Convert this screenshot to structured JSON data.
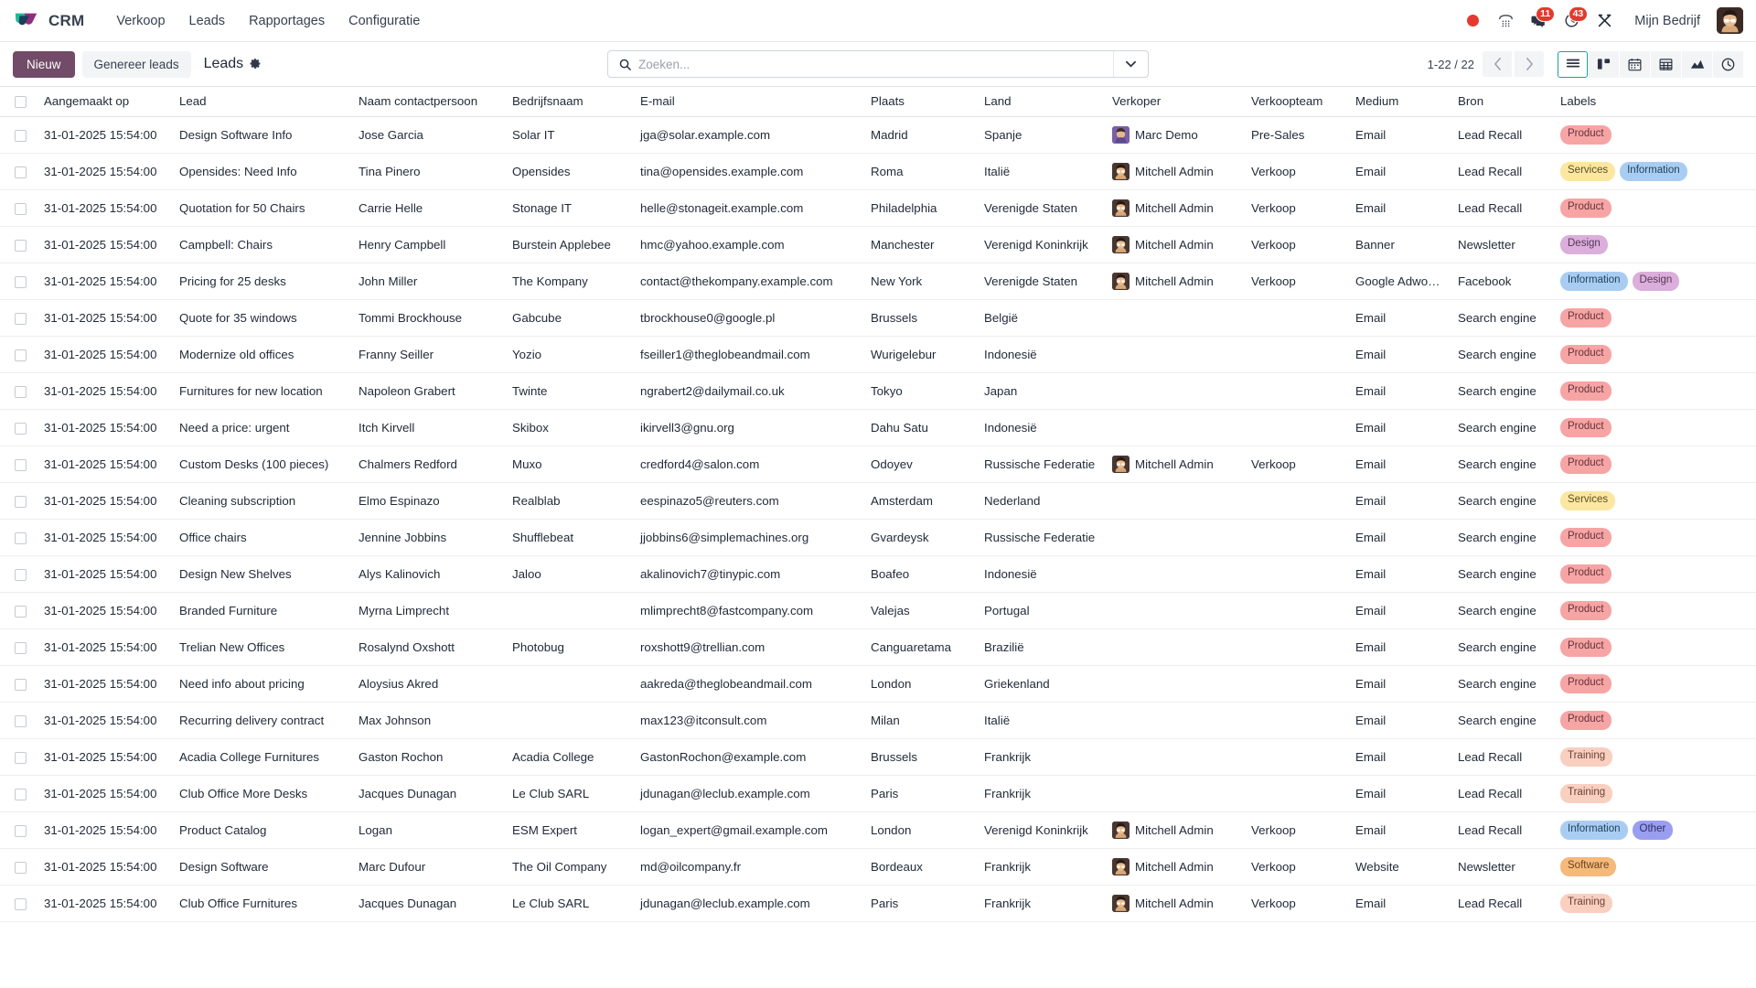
{
  "navbar": {
    "app_name": "CRM",
    "menu": [
      {
        "label": "Verkoop",
        "name": "menu-verkoop"
      },
      {
        "label": "Leads",
        "name": "menu-leads"
      },
      {
        "label": "Rapportages",
        "name": "menu-rapportages"
      },
      {
        "label": "Configuratie",
        "name": "menu-configuratie"
      }
    ],
    "systray": {
      "recording_icon": "record-dot-icon",
      "dialpad_icon": "dialpad-icon",
      "messages_icon": "messages-icon",
      "messages_count": "11",
      "activities_icon": "clock-icon",
      "activities_count": "43",
      "tools_icon": "crossed-tools-icon"
    },
    "company": "Mijn Bedrijf",
    "avatar_icon": "user-avatar"
  },
  "control_panel": {
    "new_label": "Nieuw",
    "generate_leads_label": "Genereer leads",
    "breadcrumb": "Leads",
    "settings_icon": "gear-icon",
    "search": {
      "placeholder": "Zoeken...",
      "value": "",
      "icon": "search-icon",
      "dropdown_icon": "chevron-down-icon"
    },
    "pager": "1-22 / 22",
    "prev_icon": "chevron-left-icon",
    "next_icon": "chevron-right-icon",
    "views": [
      {
        "name": "view-list",
        "label": "Lijst",
        "active": true
      },
      {
        "name": "view-kanban",
        "label": "Kanban",
        "active": false
      },
      {
        "name": "view-calendar",
        "label": "Kalender",
        "active": false
      },
      {
        "name": "view-pivot",
        "label": "Draaitabel",
        "active": false
      },
      {
        "name": "view-graph",
        "label": "Grafiek",
        "active": false
      },
      {
        "name": "view-activity",
        "label": "Activiteit",
        "active": false
      }
    ]
  },
  "list": {
    "columns": [
      {
        "label": "Aangemaakt op",
        "key": "created_on",
        "width": "148"
      },
      {
        "label": "Lead",
        "key": "lead",
        "width": "196"
      },
      {
        "label": "Naam contactpersoon",
        "key": "contact_name",
        "width": "168"
      },
      {
        "label": "Bedrijfsnaam",
        "key": "company",
        "width": "140"
      },
      {
        "label": "E-mail",
        "key": "email",
        "width": "252"
      },
      {
        "label": "Plaats",
        "key": "city",
        "width": "124"
      },
      {
        "label": "Land",
        "key": "country",
        "width": "140"
      },
      {
        "label": "Verkoper",
        "key": "salesperson",
        "width": "152"
      },
      {
        "label": "Verkoopteam",
        "key": "sales_team",
        "width": "114"
      },
      {
        "label": "Medium",
        "key": "medium",
        "width": "112"
      },
      {
        "label": "Bron",
        "key": "source",
        "width": "112"
      },
      {
        "label": "Labels",
        "key": "tags",
        "width": "204"
      }
    ],
    "optional_columns_icon": "column-settings-icon",
    "select_all_name": "select-all-checkbox",
    "rows": [
      {
        "created_on": "31-01-2025 15:54:00",
        "lead": "Design Software Info",
        "contact_name": "Jose Garcia",
        "company": "Solar IT",
        "email": "jga@solar.example.com",
        "city": "Madrid",
        "country": "Spanje",
        "salesperson": "Marc Demo",
        "avatar": "marc",
        "sales_team": "Pre-Sales",
        "medium": "Email",
        "source": "Lead Recall",
        "tags": [
          {
            "label": "Product",
            "color": "product"
          }
        ]
      },
      {
        "created_on": "31-01-2025 15:54:00",
        "lead": "Opensides: Need Info",
        "contact_name": "Tina Pinero",
        "company": "Opensides",
        "email": "tina@opensides.example.com",
        "city": "Roma",
        "country": "Italië",
        "salesperson": "Mitchell Admin",
        "avatar": "admin",
        "sales_team": "Verkoop",
        "medium": "Email",
        "source": "Lead Recall",
        "tags": [
          {
            "label": "Services",
            "color": "services"
          },
          {
            "label": "Information",
            "color": "information"
          }
        ]
      },
      {
        "created_on": "31-01-2025 15:54:00",
        "lead": "Quotation for 50 Chairs",
        "contact_name": "Carrie Helle",
        "company": "Stonage IT",
        "email": "helle@stonageit.example.com",
        "city": "Philadelphia",
        "country": "Verenigde Staten",
        "salesperson": "Mitchell Admin",
        "avatar": "admin",
        "sales_team": "Verkoop",
        "medium": "Email",
        "source": "Lead Recall",
        "tags": [
          {
            "label": "Product",
            "color": "product"
          }
        ]
      },
      {
        "created_on": "31-01-2025 15:54:00",
        "lead": "Campbell: Chairs",
        "contact_name": "Henry Campbell",
        "company": "Burstein Applebee",
        "email": "hmc@yahoo.example.com",
        "city": "Manchester",
        "country": "Verenigd Koninkrijk",
        "salesperson": "Mitchell Admin",
        "avatar": "admin",
        "sales_team": "Verkoop",
        "medium": "Banner",
        "source": "Newsletter",
        "tags": [
          {
            "label": "Design",
            "color": "design"
          }
        ]
      },
      {
        "created_on": "31-01-2025 15:54:00",
        "lead": "Pricing for 25 desks",
        "contact_name": "John Miller",
        "company": "The Kompany",
        "email": "contact@thekompany.example.com",
        "city": "New York",
        "country": "Verenigde Staten",
        "salesperson": "Mitchell Admin",
        "avatar": "admin",
        "sales_team": "Verkoop",
        "medium": "Google Adwords",
        "source": "Facebook",
        "tags": [
          {
            "label": "Information",
            "color": "information"
          },
          {
            "label": "Design",
            "color": "design"
          }
        ]
      },
      {
        "created_on": "31-01-2025 15:54:00",
        "lead": "Quote for 35 windows",
        "contact_name": "Tommi Brockhouse",
        "company": "Gabcube",
        "email": "tbrockhouse0@google.pl",
        "city": "Brussels",
        "country": "België",
        "salesperson": "",
        "avatar": "",
        "sales_team": "",
        "medium": "Email",
        "source": "Search engine",
        "tags": [
          {
            "label": "Product",
            "color": "product"
          }
        ]
      },
      {
        "created_on": "31-01-2025 15:54:00",
        "lead": "Modernize old offices",
        "contact_name": "Franny Seiller",
        "company": "Yozio",
        "email": "fseiller1@theglobeandmail.com",
        "city": "Wurigelebur",
        "country": "Indonesië",
        "salesperson": "",
        "avatar": "",
        "sales_team": "",
        "medium": "Email",
        "source": "Search engine",
        "tags": [
          {
            "label": "Product",
            "color": "product"
          }
        ]
      },
      {
        "created_on": "31-01-2025 15:54:00",
        "lead": "Furnitures for new location",
        "contact_name": "Napoleon Grabert",
        "company": "Twinte",
        "email": "ngrabert2@dailymail.co.uk",
        "city": "Tokyo",
        "country": "Japan",
        "salesperson": "",
        "avatar": "",
        "sales_team": "",
        "medium": "Email",
        "source": "Search engine",
        "tags": [
          {
            "label": "Product",
            "color": "product"
          }
        ]
      },
      {
        "created_on": "31-01-2025 15:54:00",
        "lead": "Need a price: urgent",
        "contact_name": "Itch Kirvell",
        "company": "Skibox",
        "email": "ikirvell3@gnu.org",
        "city": "Dahu Satu",
        "country": "Indonesië",
        "salesperson": "",
        "avatar": "",
        "sales_team": "",
        "medium": "Email",
        "source": "Search engine",
        "tags": [
          {
            "label": "Product",
            "color": "product"
          }
        ]
      },
      {
        "created_on": "31-01-2025 15:54:00",
        "lead": "Custom Desks (100 pieces)",
        "contact_name": "Chalmers Redford",
        "company": "Muxo",
        "email": "credford4@salon.com",
        "city": "Odoyev",
        "country": "Russische Federatie",
        "salesperson": "Mitchell Admin",
        "avatar": "admin",
        "sales_team": "Verkoop",
        "medium": "Email",
        "source": "Search engine",
        "tags": [
          {
            "label": "Product",
            "color": "product"
          }
        ]
      },
      {
        "created_on": "31-01-2025 15:54:00",
        "lead": "Cleaning subscription",
        "contact_name": "Elmo Espinazo",
        "company": "Realblab",
        "email": "eespinazo5@reuters.com",
        "city": "Amsterdam",
        "country": "Nederland",
        "salesperson": "",
        "avatar": "",
        "sales_team": "",
        "medium": "Email",
        "source": "Search engine",
        "tags": [
          {
            "label": "Services",
            "color": "services"
          }
        ]
      },
      {
        "created_on": "31-01-2025 15:54:00",
        "lead": "Office chairs",
        "contact_name": "Jennine Jobbins",
        "company": "Shufflebeat",
        "email": "jjobbins6@simplemachines.org",
        "city": "Gvardeysk",
        "country": "Russische Federatie",
        "salesperson": "",
        "avatar": "",
        "sales_team": "",
        "medium": "Email",
        "source": "Search engine",
        "tags": [
          {
            "label": "Product",
            "color": "product"
          }
        ]
      },
      {
        "created_on": "31-01-2025 15:54:00",
        "lead": "Design New Shelves",
        "contact_name": "Alys Kalinovich",
        "company": "Jaloo",
        "email": "akalinovich7@tinypic.com",
        "city": "Boafeo",
        "country": "Indonesië",
        "salesperson": "",
        "avatar": "",
        "sales_team": "",
        "medium": "Email",
        "source": "Search engine",
        "tags": [
          {
            "label": "Product",
            "color": "product"
          }
        ]
      },
      {
        "created_on": "31-01-2025 15:54:00",
        "lead": "Branded Furniture",
        "contact_name": "Myrna Limprecht",
        "company": "",
        "email": "mlimprecht8@fastcompany.com",
        "city": "Valejas",
        "country": "Portugal",
        "salesperson": "",
        "avatar": "",
        "sales_team": "",
        "medium": "Email",
        "source": "Search engine",
        "tags": [
          {
            "label": "Product",
            "color": "product"
          }
        ]
      },
      {
        "created_on": "31-01-2025 15:54:00",
        "lead": "Trelian New Offices",
        "contact_name": "Rosalynd Oxshott",
        "company": "Photobug",
        "email": "roxshott9@trellian.com",
        "city": "Canguaretama",
        "country": "Brazilië",
        "salesperson": "",
        "avatar": "",
        "sales_team": "",
        "medium": "Email",
        "source": "Search engine",
        "tags": [
          {
            "label": "Product",
            "color": "product"
          }
        ]
      },
      {
        "created_on": "31-01-2025 15:54:00",
        "lead": "Need info about pricing",
        "contact_name": "Aloysius Akred",
        "company": "",
        "email": "aakreda@theglobeandmail.com",
        "city": "London",
        "country": "Griekenland",
        "salesperson": "",
        "avatar": "",
        "sales_team": "",
        "medium": "Email",
        "source": "Search engine",
        "tags": [
          {
            "label": "Product",
            "color": "product"
          }
        ]
      },
      {
        "created_on": "31-01-2025 15:54:00",
        "lead": "Recurring delivery contract",
        "contact_name": "Max Johnson",
        "company": "",
        "email": "max123@itconsult.com",
        "city": "Milan",
        "country": "Italië",
        "salesperson": "",
        "avatar": "",
        "sales_team": "",
        "medium": "Email",
        "source": "Search engine",
        "tags": [
          {
            "label": "Product",
            "color": "product"
          }
        ]
      },
      {
        "created_on": "31-01-2025 15:54:00",
        "lead": "Acadia College Furnitures",
        "contact_name": "Gaston Rochon",
        "company": "Acadia College",
        "email": "GastonRochon@example.com",
        "city": "Brussels",
        "country": "Frankrijk",
        "salesperson": "",
        "avatar": "",
        "sales_team": "",
        "medium": "Email",
        "source": "Lead Recall",
        "tags": [
          {
            "label": "Training",
            "color": "training"
          }
        ]
      },
      {
        "created_on": "31-01-2025 15:54:00",
        "lead": "Club Office More Desks",
        "contact_name": "Jacques Dunagan",
        "company": "Le Club SARL",
        "email": "jdunagan@leclub.example.com",
        "city": "Paris",
        "country": "Frankrijk",
        "salesperson": "",
        "avatar": "",
        "sales_team": "",
        "medium": "Email",
        "source": "Lead Recall",
        "tags": [
          {
            "label": "Training",
            "color": "training"
          }
        ]
      },
      {
        "created_on": "31-01-2025 15:54:00",
        "lead": "Product Catalog",
        "contact_name": "Logan",
        "company": "ESM Expert",
        "email": "logan_expert@gmail.example.com",
        "city": "London",
        "country": "Verenigd Koninkrijk",
        "salesperson": "Mitchell Admin",
        "avatar": "admin",
        "sales_team": "Verkoop",
        "medium": "Email",
        "source": "Lead Recall",
        "tags": [
          {
            "label": "Information",
            "color": "information"
          },
          {
            "label": "Other",
            "color": "other"
          }
        ]
      },
      {
        "created_on": "31-01-2025 15:54:00",
        "lead": "Design Software",
        "contact_name": "Marc Dufour",
        "company": "The Oil Company",
        "email": "md@oilcompany.fr",
        "city": "Bordeaux",
        "country": "Frankrijk",
        "salesperson": "Mitchell Admin",
        "avatar": "admin",
        "sales_team": "Verkoop",
        "medium": "Website",
        "source": "Newsletter",
        "tags": [
          {
            "label": "Software",
            "color": "software"
          }
        ]
      },
      {
        "created_on": "31-01-2025 15:54:00",
        "lead": "Club Office Furnitures",
        "contact_name": "Jacques Dunagan",
        "company": "Le Club SARL",
        "email": "jdunagan@leclub.example.com",
        "city": "Paris",
        "country": "Frankrijk",
        "salesperson": "Mitchell Admin",
        "avatar": "admin",
        "sales_team": "Verkoop",
        "medium": "Email",
        "source": "Lead Recall",
        "tags": [
          {
            "label": "Training",
            "color": "training"
          }
        ]
      }
    ]
  },
  "colors": {
    "primary": "#714b67",
    "accent": "#17a2a2",
    "badge_red": "#e5392f",
    "tag_product": "#f7a4a4",
    "tag_services": "#fbe7a1",
    "tag_information": "#a9cdf2",
    "tag_design": "#dbaedb",
    "tag_training": "#f9cfc0",
    "tag_other": "#9a9ef0",
    "tag_software": "#f5b97a"
  }
}
